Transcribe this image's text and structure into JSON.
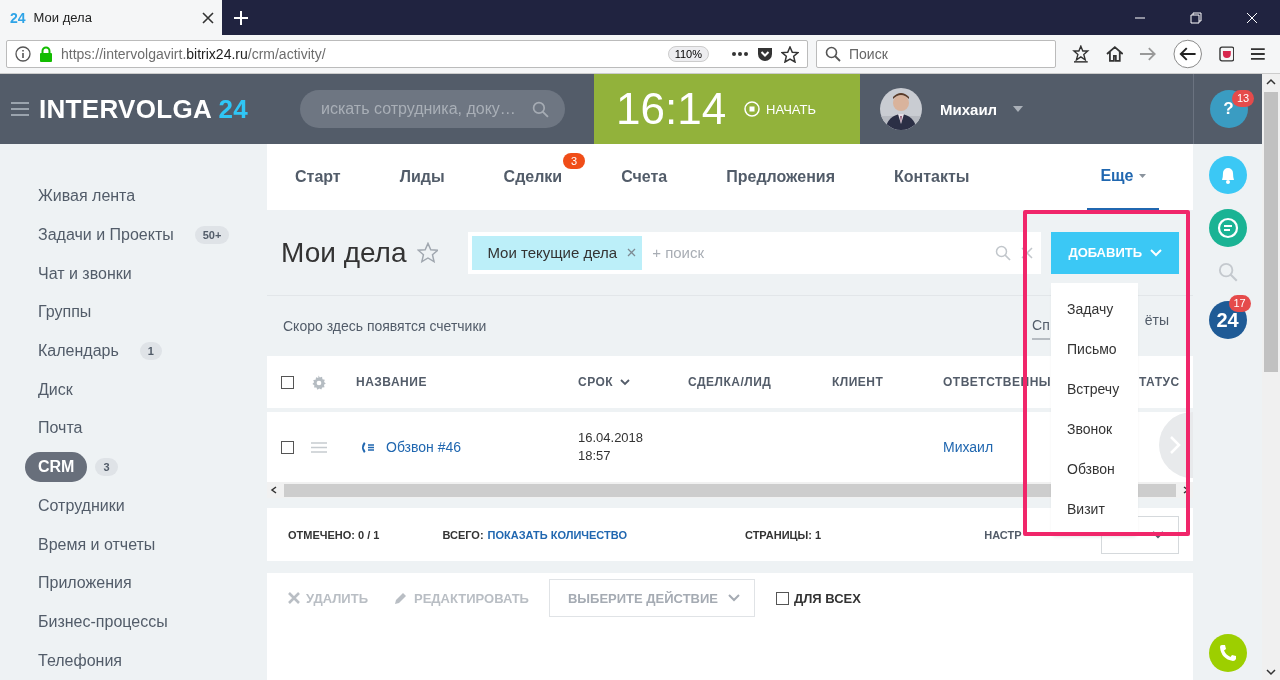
{
  "browser": {
    "tab_logo": "24",
    "tab_title": "Мои дела",
    "url_prefix": "https://intervolgavirt.",
    "url_domain": "bitrix24.ru",
    "url_path": "/crm/activity/",
    "zoom": "110%",
    "search_placeholder": "Поиск"
  },
  "header": {
    "logo": "INTERVOLGA",
    "logo_number": "24",
    "search_placeholder": "искать сотрудника, доку…",
    "time": "16:14",
    "start": "НАЧАТЬ",
    "user": "Михаил"
  },
  "sidebar": {
    "items": [
      {
        "label": "Живая лента",
        "selected": false
      },
      {
        "label": "Задачи и Проекты",
        "badge": "50+",
        "selected": false
      },
      {
        "label": "Чат и звонки",
        "selected": false
      },
      {
        "label": "Группы",
        "selected": false
      },
      {
        "label": "Календарь",
        "badge": "1",
        "selected": false
      },
      {
        "label": "Диск",
        "selected": false
      },
      {
        "label": "Почта",
        "selected": false
      },
      {
        "label": "CRM",
        "badge": "3",
        "selected": true
      },
      {
        "label": "Сотрудники",
        "selected": false
      },
      {
        "label": "Время и отчеты",
        "selected": false
      },
      {
        "label": "Приложения",
        "selected": false
      },
      {
        "label": "Бизнес-процессы",
        "selected": false
      },
      {
        "label": "Телефония",
        "selected": false
      }
    ]
  },
  "tabs": [
    {
      "label": "Старт",
      "selected": false
    },
    {
      "label": "Лиды",
      "selected": false
    },
    {
      "label": "Сделки",
      "badge": "3",
      "selected": false
    },
    {
      "label": "Счета",
      "selected": false
    },
    {
      "label": "Предложения",
      "selected": false
    },
    {
      "label": "Контакты",
      "selected": false
    },
    {
      "label": "Еще",
      "selected": true
    }
  ],
  "page": {
    "title": "Мои дела",
    "filter_tag": "Мои текущие дела",
    "filter_placeholder": "+ поиск",
    "add_button": "ДОБАВИТЬ",
    "counters": "Скоро здесь появятся счетчики",
    "view_left": "Сп",
    "view_right": "ёты"
  },
  "table": {
    "select_all_checked": false,
    "columns": [
      {
        "label": "НАЗВАНИЕ",
        "sortable": false
      },
      {
        "label": "СРОК",
        "sortable": true
      },
      {
        "label": "СДЕЛКА/ЛИД",
        "sortable": false
      },
      {
        "label": "КЛИЕНТ",
        "sortable": false
      },
      {
        "label": "ОТВЕТСТВЕННЫ"
      },
      {
        "label": "ТАТУС"
      }
    ],
    "rows": [
      {
        "checked": false,
        "title": "Обзвон #46",
        "date": "16.04.2018",
        "time": "18:57",
        "responsible": "Михаил"
      }
    ]
  },
  "footer": {
    "marked_label": "ОТМЕЧЕНО:",
    "marked_value": "0 / 1",
    "total_label": "ВСЕГО:",
    "total_link": "ПОКАЗАТЬ КОЛИЧЕСТВО",
    "pages_label": "СТРАНИЦЫ:",
    "pages_value": "1",
    "settings_label": "НАСТР"
  },
  "actions": {
    "delete": "УДАЛИТЬ",
    "edit": "РЕДАКТИРОВАТЬ",
    "select": "ВЫБЕРИТЕ ДЕЙСТВИЕ",
    "for_all": {
      "label": "ДЛЯ ВСЕХ",
      "checked": false
    }
  },
  "add_menu": {
    "items": [
      "Задачу",
      "Письмо",
      "Встречу",
      "Звонок",
      "Обзвон",
      "Визит"
    ]
  },
  "right_rail": {
    "help": "?",
    "help_badge": "13",
    "b24": "24",
    "b24_badge": "17"
  }
}
